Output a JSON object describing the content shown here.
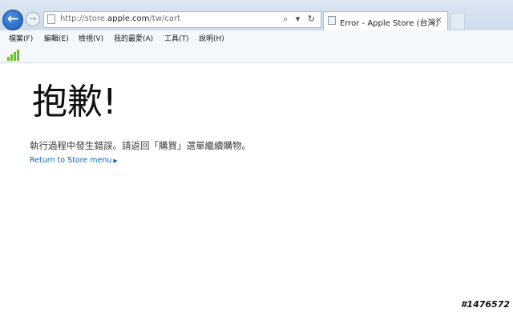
{
  "browser": {
    "url_prefix": "http://store.",
    "url_domain": "apple.com",
    "url_path": "/tw/cart",
    "tab_title": "Error - Apple Store (台灣)",
    "tab_close": "×",
    "address_icons": "⌕ ▾ ↻"
  },
  "menu": {
    "items": [
      "檔案(F)",
      "編輯(E)",
      "檢視(V)",
      "我的最愛(A)",
      "工具(T)",
      "說明(H)"
    ]
  },
  "page": {
    "title": "抱歉!",
    "message": "執行過程中發生錯誤。請返回「購買」選單繼續購物。",
    "return_link": "Return to Store menu",
    "return_arrow": "▶"
  },
  "watermark": "#1476572",
  "colors": {
    "link": "#0b63c6",
    "back_button": "#1a5cb8",
    "signal_bars": "#6cbf2f"
  }
}
